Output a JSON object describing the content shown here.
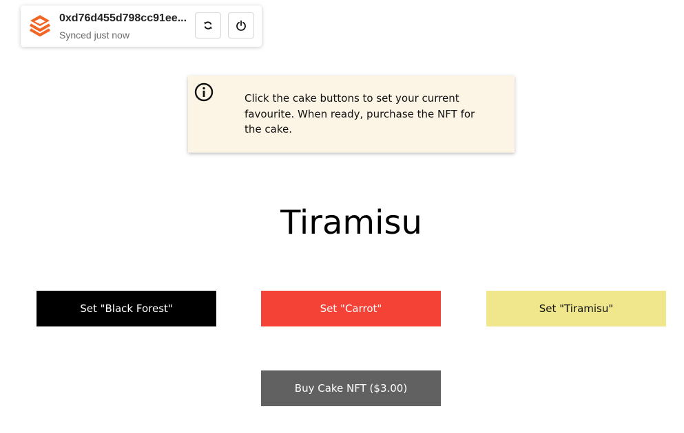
{
  "wallet": {
    "address": "0xd76d455d798cc91ee...",
    "status": "Synced just now",
    "logo_icon": "layered-stack-logo-icon",
    "sync_icon": "sync-icon",
    "power_icon": "power-icon",
    "brand_color": "#f26522"
  },
  "info_banner": {
    "icon": "info-icon",
    "text": "Click the cake buttons to set your current favourite. When ready, purchase the NFT for the cake.",
    "background": "#fcf4e4"
  },
  "current_cake": "Tiramisu",
  "buttons": {
    "black_forest": {
      "label": "Set \"Black Forest\"",
      "color": "#000000"
    },
    "carrot": {
      "label": "Set \"Carrot\"",
      "color": "#f44336"
    },
    "tiramisu": {
      "label": "Set \"Tiramisu\"",
      "color": "#f0e68c"
    },
    "buy": {
      "label": "Buy Cake NFT ($3.00)",
      "color": "#616161"
    }
  }
}
